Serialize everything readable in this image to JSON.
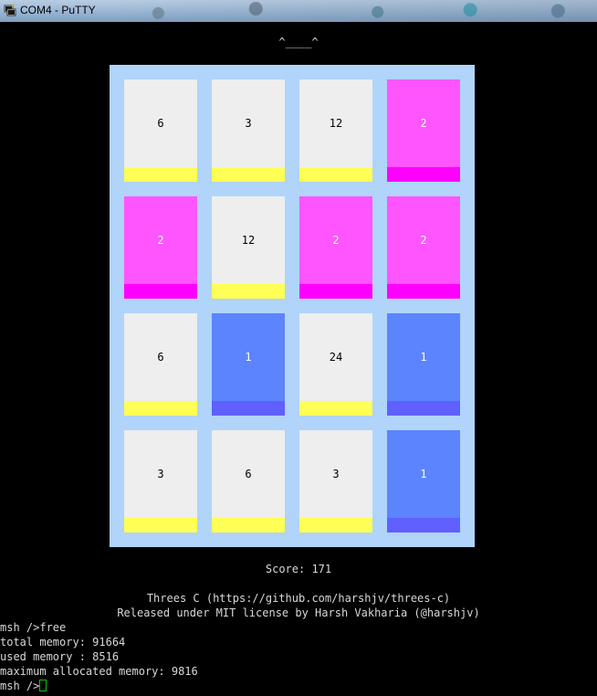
{
  "window": {
    "title": "COM4 - PuTTY"
  },
  "game": {
    "face": "^____^",
    "board": [
      [
        {
          "value": "6",
          "color": "gray"
        },
        {
          "value": "3",
          "color": "gray"
        },
        {
          "value": "12",
          "color": "gray"
        },
        {
          "value": "2",
          "color": "pink"
        }
      ],
      [
        {
          "value": "2",
          "color": "pink"
        },
        {
          "value": "12",
          "color": "gray"
        },
        {
          "value": "2",
          "color": "pink"
        },
        {
          "value": "2",
          "color": "pink"
        }
      ],
      [
        {
          "value": "6",
          "color": "gray"
        },
        {
          "value": "1",
          "color": "blue"
        },
        {
          "value": "24",
          "color": "gray"
        },
        {
          "value": "1",
          "color": "blue"
        }
      ],
      [
        {
          "value": "3",
          "color": "gray"
        },
        {
          "value": "6",
          "color": "gray"
        },
        {
          "value": "3",
          "color": "gray"
        },
        {
          "value": "1",
          "color": "blue"
        }
      ]
    ],
    "score_line": "Score: 171",
    "credit_line1": "Threes C (https://github.com/harshjv/threes-c)",
    "credit_line2": "Released under MIT license by Harsh Vakharia (@harshjv)"
  },
  "shell": {
    "lines": [
      "msh />free",
      "total memory: 91664",
      "used memory : 8516",
      "maximum allocated memory: 9816"
    ],
    "prompt": "msh />"
  },
  "colors": {
    "board_bg": "#b0d4fa",
    "gray_face": "#eeeeee",
    "gray_base": "#ffff55",
    "pink_face": "#ff55ff",
    "pink_base": "#ff00ff",
    "blue_face": "#5c84ff",
    "blue_base": "#6060ff",
    "cursor": "#00c800"
  }
}
